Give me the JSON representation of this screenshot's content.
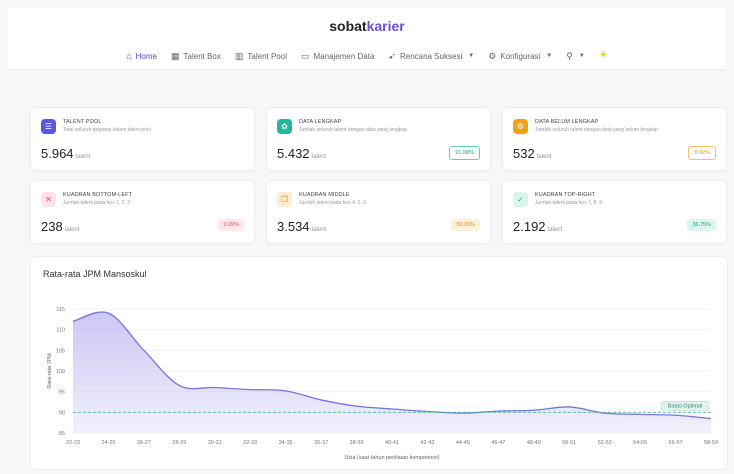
{
  "brand": {
    "pre": "sobat",
    "post": "karier"
  },
  "nav": [
    {
      "icon": "home-icon",
      "glyph": "⌂",
      "label": "Home",
      "active": true
    },
    {
      "icon": "grid-icon",
      "glyph": "▦",
      "label": "Talent Box"
    },
    {
      "icon": "pool-icon",
      "glyph": "▥",
      "label": "Talent Pool"
    },
    {
      "icon": "data-icon",
      "glyph": "▭",
      "label": "Manajemen Data"
    },
    {
      "icon": "send-icon",
      "glyph": "➹",
      "label": "Rencana Suksesi",
      "dropdown": true
    },
    {
      "icon": "gear-icon",
      "glyph": "⚙",
      "label": "Konfigurasi",
      "dropdown": true
    },
    {
      "icon": "user-icon",
      "glyph": "⚲",
      "label": "",
      "dropdown": true
    },
    {
      "icon": "sun-icon",
      "glyph": "☀",
      "label": ""
    }
  ],
  "cards": [
    {
      "title": "TALENT POOL",
      "subtitle": "Total seluruh pegawai dalam talent pool",
      "value": "5.964",
      "unit": "talent",
      "pct": "",
      "icon": "users-icon",
      "iconColor": "#5b56e0",
      "pctColor": "",
      "pctBg": ""
    },
    {
      "title": "DATA LENGKAP",
      "subtitle": "Jumlah seluruh talent dengan data yang lengkap",
      "value": "5.432",
      "unit": "talent",
      "pct": "91.08%",
      "icon": "check-gear-icon",
      "iconColor": "#21b79e",
      "pctColor": "#1aa58d",
      "pctBg": "#ffffff",
      "pctBorder": "#5fd0bc"
    },
    {
      "title": "DATA BELUM LENGKAP",
      "subtitle": "Jumlah seluruh talent dengan data yang belum lengkap",
      "value": "532",
      "unit": "talent",
      "pct": "8.92%",
      "icon": "warning-icon",
      "iconColor": "#f2a21a",
      "pctColor": "#e39614",
      "pctBg": "#ffffff",
      "pctBorder": "#f4c46a"
    },
    {
      "title": "KUADRAN BOTTOM-LEFT",
      "subtitle": "Jumlah talent pada box 1, 2, 3",
      "value": "238",
      "unit": "talent",
      "pct": "3.99%",
      "icon": "box-x-icon",
      "iconColor": "#fde3e6",
      "iconText": "#e05064",
      "pctColor": "#e05064",
      "pctBg": "#fde7ea"
    },
    {
      "title": "KUADRAN MIDDLE",
      "subtitle": "Jumlah talent pada box 4, 5, 6",
      "value": "3.534",
      "unit": "talent",
      "pct": "59.26%",
      "icon": "box-copy-icon",
      "iconColor": "#fdeccf",
      "iconText": "#e59a1a",
      "pctColor": "#e08f15",
      "pctBg": "#fdf0d9"
    },
    {
      "title": "KUADRAN TOP-RIGHT",
      "subtitle": "Jumlah talent pada box 7, 8, 9",
      "value": "2.192",
      "unit": "talent",
      "pct": "36.75%",
      "icon": "box-check-icon",
      "iconColor": "#d9f5ee",
      "iconText": "#1aa58d",
      "pctColor": "#1a9a82",
      "pctBg": "#dcf6ef"
    }
  ],
  "chart_data": {
    "type": "area",
    "title": "Rata-rata JPM Mansoskul",
    "xlabel": "Usia (saat tahun penilaian kompetensi)",
    "ylabel": "Rata-rata JPM",
    "categories": [
      "22-23",
      "24-25",
      "26-27",
      "28-29",
      "30-31",
      "32-33",
      "34-35",
      "36-37",
      "38-39",
      "40-41",
      "42-43",
      "44-45",
      "46-47",
      "48-49",
      "50-51",
      "52-53",
      "54-55",
      "56-57",
      "58-59"
    ],
    "values": [
      112,
      114,
      105,
      96.5,
      96,
      95.5,
      95.2,
      93,
      91.5,
      90.8,
      90.2,
      89.8,
      90.3,
      90.5,
      91.3,
      89.8,
      89.5,
      89.3,
      88.5
    ],
    "ylim": [
      85,
      115
    ],
    "yticks": [
      85,
      90,
      95,
      100,
      105,
      110,
      115
    ],
    "reference": {
      "value": 90,
      "label": "Batas Optimal"
    },
    "colors": {
      "line": "#7b73d9",
      "fill": "#c9c4f3",
      "reference": "#4fb89a"
    },
    "grid": true
  }
}
